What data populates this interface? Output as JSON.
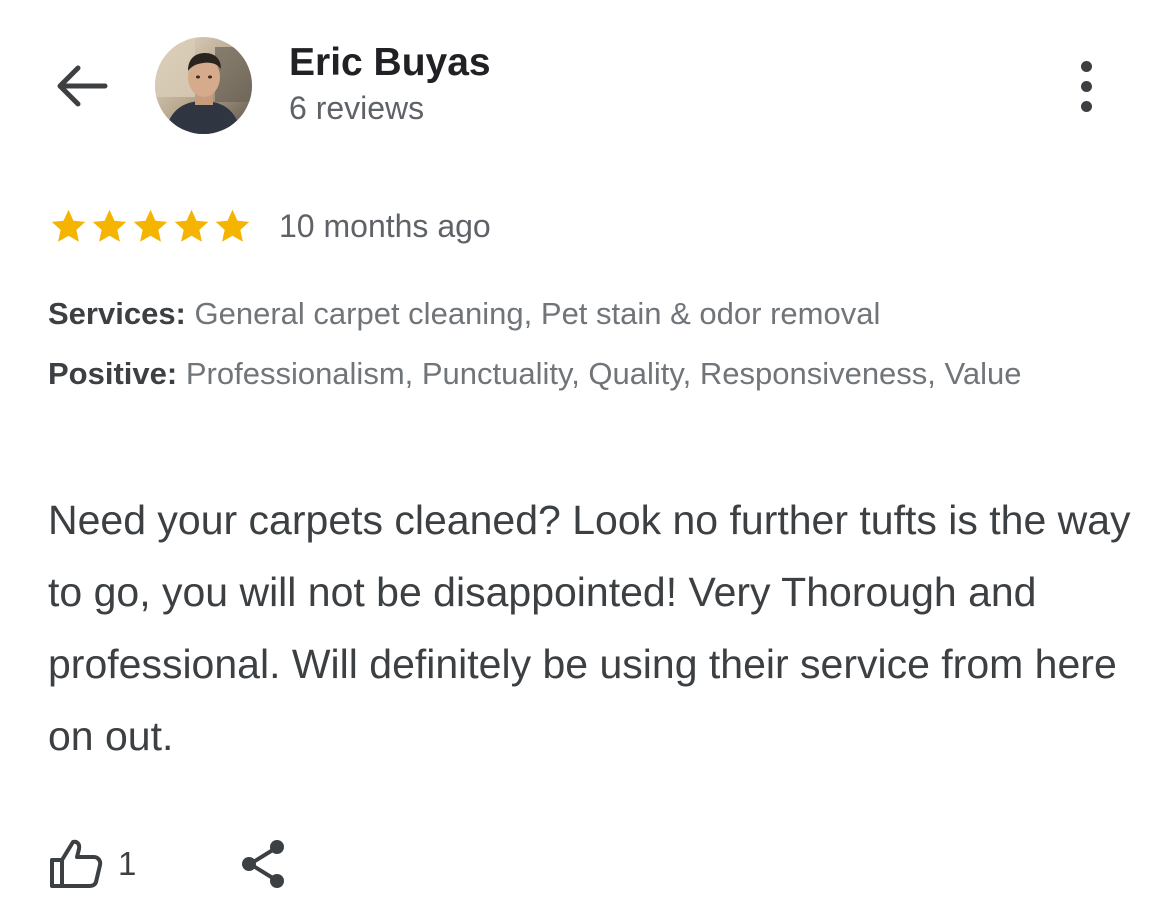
{
  "header": {
    "back_icon": "arrow-back-icon",
    "reviewer_name": "Eric Buyas",
    "review_count": "6 reviews",
    "more_icon": "more-vert-icon"
  },
  "review": {
    "rating": 5,
    "rating_max": 5,
    "star_color": "#F4B400",
    "time_ago": "10 months ago",
    "services_label": "Services:",
    "services_value": "General carpet cleaning, Pet stain & odor removal",
    "positive_label": "Positive:",
    "positive_value": "Professionalism, Punctuality, Quality, Responsiveness, Value",
    "text": "Need your carpets cleaned? Look no further tufts is the way to go, you will not be disappointed! Very Thorough and professional. Will definitely be using their service from here on out."
  },
  "actions": {
    "like_icon": "thumb-up-icon",
    "like_count": "1",
    "share_icon": "share-icon"
  }
}
